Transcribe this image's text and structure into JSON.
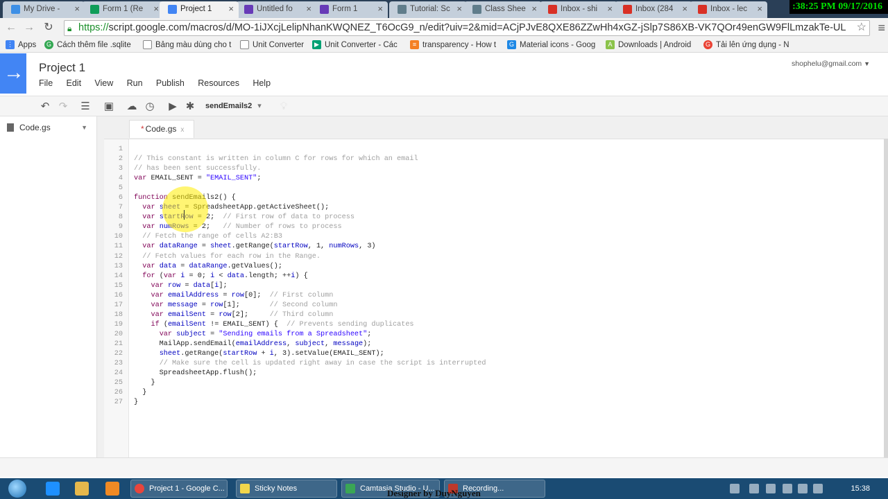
{
  "browser": {
    "tabs": [
      {
        "label": "My Drive - ",
        "icon_color": "#3d8fe6"
      },
      {
        "label": "Form 1 (Re",
        "icon_color": "#0f9d58"
      },
      {
        "label": "Project 1",
        "icon_color": "#4285f4",
        "active": true
      },
      {
        "label": "Untitled fo",
        "icon_color": "#673ab7"
      },
      {
        "label": "Form 1",
        "icon_color": "#673ab7"
      },
      {
        "label": "Tutorial: Sc",
        "icon_color": "#607d8b"
      },
      {
        "label": "Class Shee",
        "icon_color": "#607d8b"
      },
      {
        "label": "Inbox - shi",
        "icon_color": "#d93025"
      },
      {
        "label": "Inbox (284",
        "icon_color": "#d93025"
      },
      {
        "label": "Inbox - lec",
        "icon_color": "#d93025"
      }
    ],
    "clock_overlay": ":38:25 PM 09/17/2016",
    "url_protocol": "https://",
    "url_rest": "script.google.com/macros/d/MO-1iJXcjLelipNhanKWQNEZ_T6OcG9_n/edit?uiv=2&mid=ACjPJvE8QXE86ZZwHh4xGZ-jSlp7S86XB-VK7QOr49enGW9FlLmzakTe-UL",
    "bookmarks": [
      {
        "label": "Apps",
        "icon": "apps-grid-icon",
        "color": "#4285f4"
      },
      {
        "label": "Cách thêm file .sqlite",
        "icon": "google-icon",
        "color": "#34a853"
      },
      {
        "label": "Bảng màu dùng cho t",
        "icon": "page-icon",
        "color": "#888888"
      },
      {
        "label": "Unit Converter",
        "icon": "page-icon",
        "color": "#888888"
      },
      {
        "label": "Unit Converter - Các",
        "icon": "play-store-icon",
        "color": "#00a173"
      },
      {
        "label": "transparency - How t",
        "icon": "stack-icon",
        "color": "#f48024"
      },
      {
        "label": "Material icons - Goog",
        "icon": "go-icon",
        "color": "#1e88e5"
      },
      {
        "label": "Downloads | Android",
        "icon": "android-icon",
        "color": "#8bc34a"
      },
      {
        "label": "Tải lên ứng dụng - N",
        "icon": "google-icon",
        "color": "#ea4335"
      }
    ]
  },
  "app": {
    "title": "Project 1",
    "account": "shophelu@gmail.com",
    "menu": [
      "File",
      "Edit",
      "View",
      "Run",
      "Publish",
      "Resources",
      "Help"
    ],
    "function_select": "sendEmails2",
    "file_name": "Code.gs",
    "tab_name": "Code.gs",
    "tab_modified_marker": "*",
    "tab_close": "x"
  },
  "code_lines": [
    [],
    [
      [
        "c",
        "// This constant is written in column C for rows for which an email"
      ]
    ],
    [
      [
        "c",
        "// has been sent successfully."
      ]
    ],
    [
      [
        "k",
        "var"
      ],
      [
        "t",
        " EMAIL_SENT = "
      ],
      [
        "s",
        "\"EMAIL_SENT\""
      ],
      [
        "t",
        ";"
      ]
    ],
    [],
    [
      [
        "k",
        "function"
      ],
      [
        "t",
        " sendEmails2() {"
      ]
    ],
    [
      [
        "t",
        "  "
      ],
      [
        "k",
        "var"
      ],
      [
        "t",
        " "
      ],
      [
        "v",
        "sheet"
      ],
      [
        "t",
        " = SpreadsheetApp.getActiveSheet();"
      ]
    ],
    [
      [
        "t",
        "  "
      ],
      [
        "k",
        "var"
      ],
      [
        "t",
        " "
      ],
      [
        "v",
        "startRow"
      ],
      [
        "t",
        " = 2;  "
      ],
      [
        "c",
        "// First row of data to process"
      ]
    ],
    [
      [
        "t",
        "  "
      ],
      [
        "k",
        "var"
      ],
      [
        "t",
        " "
      ],
      [
        "v",
        "numRows"
      ],
      [
        "t",
        " = 2;   "
      ],
      [
        "c",
        "// Number of rows to process"
      ]
    ],
    [
      [
        "t",
        "  "
      ],
      [
        "c",
        "// Fetch the range of cells A2:B3"
      ]
    ],
    [
      [
        "t",
        "  "
      ],
      [
        "k",
        "var"
      ],
      [
        "t",
        " "
      ],
      [
        "v",
        "dataRange"
      ],
      [
        "t",
        " = "
      ],
      [
        "v",
        "sheet"
      ],
      [
        "t",
        ".getRange("
      ],
      [
        "v",
        "startRow"
      ],
      [
        "t",
        ", 1, "
      ],
      [
        "v",
        "numRows"
      ],
      [
        "t",
        ", 3)"
      ]
    ],
    [
      [
        "t",
        "  "
      ],
      [
        "c",
        "// Fetch values for each row in the Range."
      ]
    ],
    [
      [
        "t",
        "  "
      ],
      [
        "k",
        "var"
      ],
      [
        "t",
        " "
      ],
      [
        "v",
        "data"
      ],
      [
        "t",
        " = "
      ],
      [
        "v",
        "dataRange"
      ],
      [
        "t",
        ".getValues();"
      ]
    ],
    [
      [
        "t",
        "  "
      ],
      [
        "k",
        "for"
      ],
      [
        "t",
        " ("
      ],
      [
        "k",
        "var"
      ],
      [
        "t",
        " "
      ],
      [
        "v",
        "i"
      ],
      [
        "t",
        " = 0; "
      ],
      [
        "v",
        "i"
      ],
      [
        "t",
        " < "
      ],
      [
        "v",
        "data"
      ],
      [
        "t",
        ".length; ++"
      ],
      [
        "v",
        "i"
      ],
      [
        "t",
        ") {"
      ]
    ],
    [
      [
        "t",
        "    "
      ],
      [
        "k",
        "var"
      ],
      [
        "t",
        " "
      ],
      [
        "v",
        "row"
      ],
      [
        "t",
        " = "
      ],
      [
        "v",
        "data"
      ],
      [
        "t",
        "["
      ],
      [
        "v",
        "i"
      ],
      [
        "t",
        "];"
      ]
    ],
    [
      [
        "t",
        "    "
      ],
      [
        "k",
        "var"
      ],
      [
        "t",
        " "
      ],
      [
        "v",
        "emailAddress"
      ],
      [
        "t",
        " = "
      ],
      [
        "v",
        "row"
      ],
      [
        "t",
        "[0];  "
      ],
      [
        "c",
        "// First column"
      ]
    ],
    [
      [
        "t",
        "    "
      ],
      [
        "k",
        "var"
      ],
      [
        "t",
        " "
      ],
      [
        "v",
        "message"
      ],
      [
        "t",
        " = "
      ],
      [
        "v",
        "row"
      ],
      [
        "t",
        "[1];       "
      ],
      [
        "c",
        "// Second column"
      ]
    ],
    [
      [
        "t",
        "    "
      ],
      [
        "k",
        "var"
      ],
      [
        "t",
        " "
      ],
      [
        "v",
        "emailSent"
      ],
      [
        "t",
        " = "
      ],
      [
        "v",
        "row"
      ],
      [
        "t",
        "[2];     "
      ],
      [
        "c",
        "// Third column"
      ]
    ],
    [
      [
        "t",
        "    "
      ],
      [
        "k",
        "if"
      ],
      [
        "t",
        " ("
      ],
      [
        "v",
        "emailSent"
      ],
      [
        "t",
        " != EMAIL_SENT) {  "
      ],
      [
        "c",
        "// Prevents sending duplicates"
      ]
    ],
    [
      [
        "t",
        "      "
      ],
      [
        "k",
        "var"
      ],
      [
        "t",
        " "
      ],
      [
        "v",
        "subject"
      ],
      [
        "t",
        " = "
      ],
      [
        "s",
        "\"Sending emails from a Spreadsheet\""
      ],
      [
        "t",
        ";"
      ]
    ],
    [
      [
        "t",
        "      MailApp.sendEmail("
      ],
      [
        "v",
        "emailAddress"
      ],
      [
        "t",
        ", "
      ],
      [
        "v",
        "subject"
      ],
      [
        "t",
        ", "
      ],
      [
        "v",
        "message"
      ],
      [
        "t",
        ");"
      ]
    ],
    [
      [
        "t",
        "      "
      ],
      [
        "v",
        "sheet"
      ],
      [
        "t",
        ".getRange("
      ],
      [
        "v",
        "startRow"
      ],
      [
        "t",
        " + "
      ],
      [
        "v",
        "i"
      ],
      [
        "t",
        ", 3).setValue(EMAIL_SENT);"
      ]
    ],
    [
      [
        "t",
        "      "
      ],
      [
        "c",
        "// Make sure the cell is updated right away in case the script is interrupted"
      ]
    ],
    [
      [
        "t",
        "      SpreadsheetApp.flush();"
      ]
    ],
    [
      [
        "t",
        "    }"
      ]
    ],
    [
      [
        "t",
        "  }"
      ]
    ],
    [
      [
        "t",
        "}"
      ]
    ]
  ],
  "taskbar": {
    "tasks": [
      {
        "label": "Project 1 - Google C...",
        "color": "#e8453c"
      },
      {
        "label": "Sticky Notes",
        "color": "#f2d64b"
      },
      {
        "label": "Camtasia Studio - U...",
        "color": "#3aa655"
      },
      {
        "label": "Recording...",
        "color": "#c0392b"
      }
    ],
    "designer": "Designer by DuyNguyen",
    "time": "15:38"
  }
}
